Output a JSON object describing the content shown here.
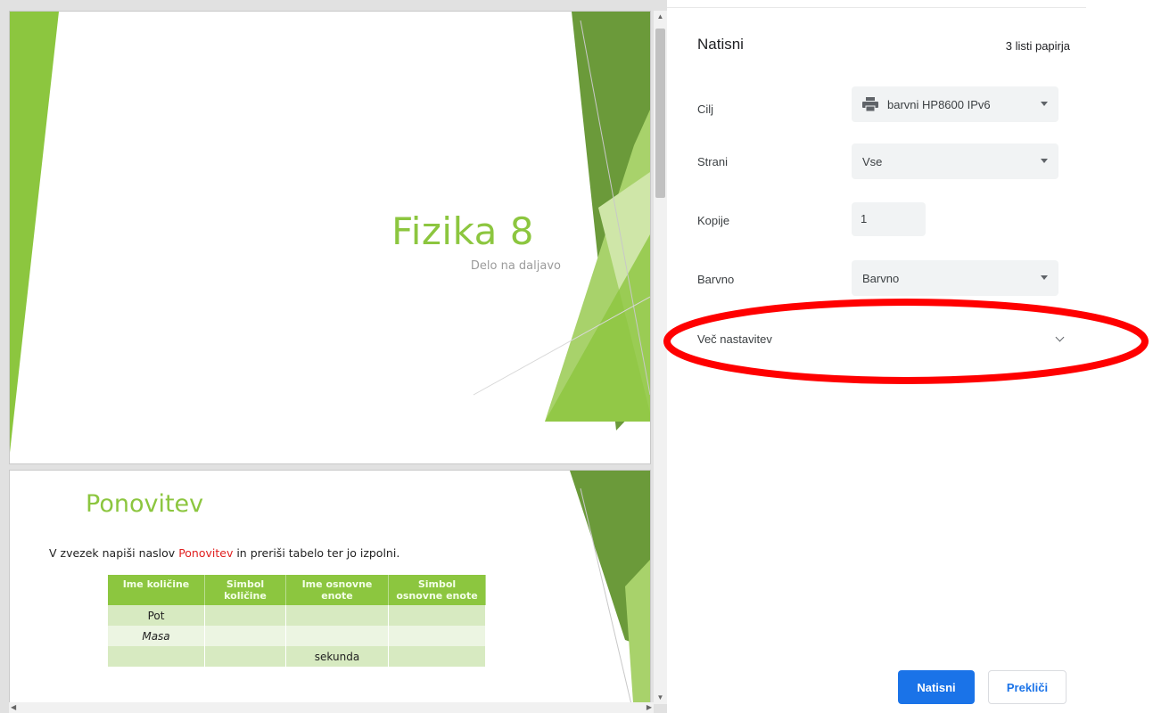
{
  "preview": {
    "slide1": {
      "title": "Fizika 8",
      "subtitle": "Delo na daljavo"
    },
    "slide2": {
      "title": "Ponovitev",
      "instruction_before": "V zvezek napiši naslov ",
      "instruction_highlight": "Ponovitev",
      "instruction_after": " in preriši tabelo ter jo izpolni.",
      "table": {
        "headers": [
          "Ime količine",
          "Simbol količine",
          "Ime osnovne enote",
          "Simbol osnovne enote"
        ],
        "rows": [
          [
            "Pot",
            "",
            "",
            ""
          ],
          [
            "Masa",
            "",
            "",
            ""
          ],
          [
            "",
            "",
            "sekunda",
            ""
          ]
        ]
      }
    }
  },
  "panel": {
    "title": "Natisni",
    "sheet_count": "3 listi papirja",
    "destination": {
      "label": "Cilj",
      "value": "barvni HP8600 IPv6"
    },
    "pages": {
      "label": "Strani",
      "value": "Vse"
    },
    "copies": {
      "label": "Kopije",
      "value": "1"
    },
    "color": {
      "label": "Barvno",
      "value": "Barvno"
    },
    "more_settings": "Več nastavitev",
    "print_button": "Natisni",
    "cancel_button": "Prekliči"
  },
  "colors": {
    "accent_green": "#8cc63f",
    "dark_green": "#6b9a3a",
    "button_blue": "#1a73e8",
    "annotation_red": "#ff0000"
  }
}
